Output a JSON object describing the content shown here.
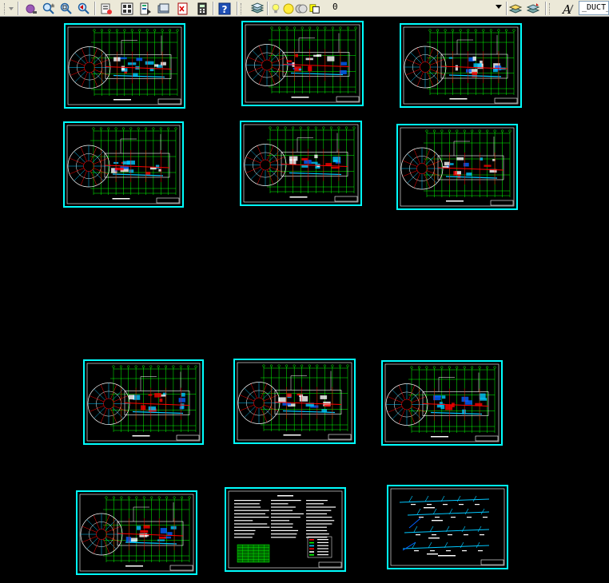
{
  "toolbar": {
    "layer_name": "0",
    "text_style": "_DUCT_",
    "left_icons": [
      "realtime-pan-icon",
      "zoom-realtime-icon",
      "zoom-window-icon",
      "zoom-previous-icon",
      "properties-icon",
      "design-center-icon",
      "tool-palettes-icon",
      "sheet-set-icon",
      "markup-icon",
      "quickcalc-icon",
      "help-icon"
    ],
    "layer_icons": [
      "layer-manager-icon",
      "bulb-icon",
      "sun-icon",
      "lock-icon",
      "color-swatch-icon"
    ],
    "right_icons": [
      "make-current-layer-icon",
      "layer-previous-icon",
      "text-style-icon"
    ]
  },
  "colors": {
    "sheet_border": "#00ffff",
    "grid": "#00ff00",
    "wall": "#ff0000",
    "duct": "#00c8ff",
    "equipment": "#ffffff",
    "accent": "#0060ff",
    "background": "#000000"
  },
  "sheets": [
    {
      "kind": "plan",
      "round": "left"
    },
    {
      "kind": "plan",
      "round": "left"
    },
    {
      "kind": "plan",
      "round": "left"
    },
    {
      "kind": "plan",
      "round": "left"
    },
    {
      "kind": "plan",
      "round": "left"
    },
    {
      "kind": "plan",
      "round": "left"
    },
    {
      "kind": "plan",
      "round": "left"
    },
    {
      "kind": "plan",
      "round": "left"
    },
    {
      "kind": "plan",
      "round": "left"
    },
    {
      "kind": "plan",
      "round": "left"
    },
    {
      "kind": "notes"
    },
    {
      "kind": "system"
    }
  ]
}
